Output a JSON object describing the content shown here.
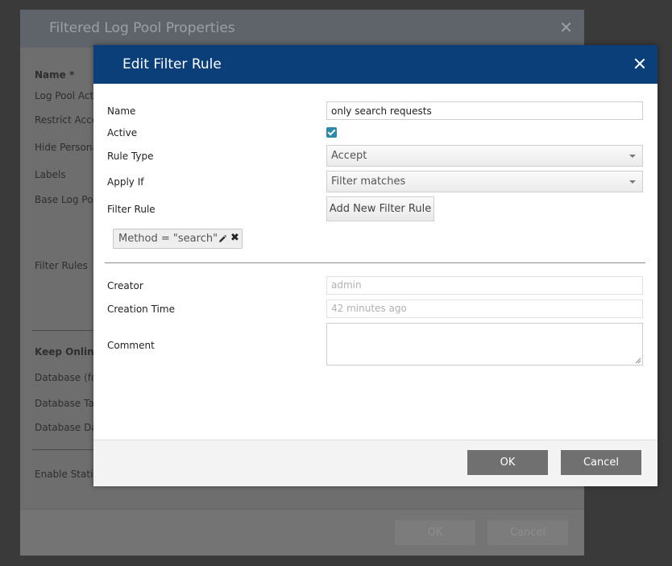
{
  "background_dialog": {
    "title": "Filtered Log Pool Properties",
    "close_glyph": "✕",
    "labels": {
      "name": "Name *",
      "log_pool_active": "Log Pool Active",
      "restrict_access": "Restrict Access",
      "hide_personal": "Hide Personal",
      "labels": "Labels",
      "base_log_pool": "Base Log Pool",
      "filter_rules": "Filter Rules",
      "keep_online": "Keep Online L",
      "database_for": "Database (for",
      "database_table": "Database Tab",
      "database_data": "Database Dat",
      "enable_statistics": "Enable Statist"
    },
    "ok_label": "OK",
    "cancel_label": "Cancel"
  },
  "dialog": {
    "title": "Edit Filter Rule",
    "fields": {
      "name_label": "Name",
      "name_value": "only search requests",
      "active_label": "Active",
      "active_checked": true,
      "rule_type_label": "Rule Type",
      "rule_type_value": "Accept",
      "apply_if_label": "Apply If",
      "apply_if_value": "Filter matches",
      "filter_rule_label": "Filter Rule",
      "add_filter_label": "Add New Filter Rule",
      "filter_tag": "Method = \"search\"",
      "remove_glyph": "✖",
      "creator_label": "Creator",
      "creator_value": "admin",
      "creation_time_label": "Creation Time",
      "creation_time_value": "42 minutes ago",
      "comment_label": "Comment",
      "comment_value": ""
    },
    "footer": {
      "ok_label": "OK",
      "cancel_label": "Cancel"
    }
  },
  "colors": {
    "header_blue": "#0a3f7a",
    "checkbox_teal": "#2d8aa8",
    "button_gray": "#707070"
  }
}
